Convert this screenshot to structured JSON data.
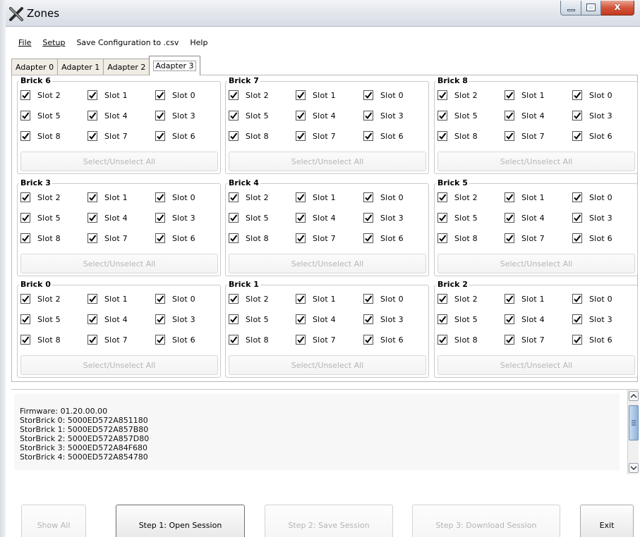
{
  "window": {
    "title": "Zones",
    "close_glyph": "x"
  },
  "menu": [
    {
      "label": "File"
    },
    {
      "label": "Setup"
    },
    {
      "label": "Save Configuration to .csv"
    },
    {
      "label": "Help"
    }
  ],
  "tabs": [
    {
      "label": "Adapter 0",
      "active": false
    },
    {
      "label": "Adapter 1",
      "active": false
    },
    {
      "label": "Adapter 2",
      "active": false
    },
    {
      "label": "Adapter 3",
      "active": true
    }
  ],
  "slot_labels": [
    "Slot 2",
    "Slot 1",
    "Slot 0",
    "Slot 5",
    "Slot 4",
    "Slot 3",
    "Slot 8",
    "Slot 7",
    "Slot 6"
  ],
  "select_all_label": "Select/Unselect All",
  "bricks": [
    {
      "title": "Brick 6"
    },
    {
      "title": "Brick 7"
    },
    {
      "title": "Brick 8"
    },
    {
      "title": "Brick 3"
    },
    {
      "title": "Brick 4"
    },
    {
      "title": "Brick 5"
    },
    {
      "title": "Brick 0"
    },
    {
      "title": "Brick 1"
    },
    {
      "title": "Brick 2"
    }
  ],
  "all_slots_checked": true,
  "log": [
    "Firmware: 01.20.00.00",
    "StorBrick 0: 5000ED572A851180",
    "StorBrick 1: 5000ED572A857B80",
    "StorBrick 2: 5000ED572A857D80",
    "StorBrick 3: 5000ED572A84F680",
    "StorBrick 4: 5000ED572A854780"
  ],
  "buttons": {
    "show_all": "Show All",
    "step1": "Step 1: Open Session",
    "step2": "Step 2: Save Session",
    "step3": "Step 3: Download Session",
    "exit": "Exit"
  },
  "colors": {
    "disabled_text": "#b4b4b4",
    "close_button": "#d4553b",
    "tab_inactive_bg": "#f1ece4"
  }
}
